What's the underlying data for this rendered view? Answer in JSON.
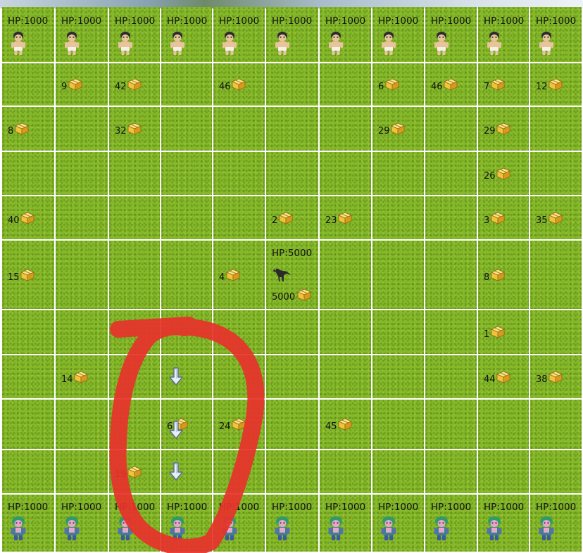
{
  "colors": {
    "grass": "#86b82a",
    "marker": "#e8312b",
    "crate": "#f2c23a",
    "top_figure_skin": "#e9c49a",
    "bottom_figure": "#3f7f8f"
  },
  "top_row": {
    "hp_label": "HP:1000",
    "columns": 11
  },
  "bottom_row": {
    "hp_label": "HP:1000",
    "columns": 11
  },
  "boss": {
    "hp_label": "HP:5000",
    "value": "5000",
    "icon": "dinosaur-icon"
  },
  "crates": [
    {
      "r": 1,
      "c": 1,
      "v": "9"
    },
    {
      "r": 1,
      "c": 2,
      "v": "42"
    },
    {
      "r": 1,
      "c": 4,
      "v": "46"
    },
    {
      "r": 1,
      "c": 7,
      "v": "6"
    },
    {
      "r": 1,
      "c": 8,
      "v": "46"
    },
    {
      "r": 1,
      "c": 9,
      "v": "7"
    },
    {
      "r": 1,
      "c": 10,
      "v": "12"
    },
    {
      "r": 2,
      "c": 0,
      "v": "8"
    },
    {
      "r": 2,
      "c": 2,
      "v": "32"
    },
    {
      "r": 2,
      "c": 7,
      "v": "29"
    },
    {
      "r": 2,
      "c": 9,
      "v": "29"
    },
    {
      "r": 3,
      "c": 9,
      "v": "26"
    },
    {
      "r": 4,
      "c": 0,
      "v": "40"
    },
    {
      "r": 4,
      "c": 5,
      "v": "2"
    },
    {
      "r": 4,
      "c": 6,
      "v": "23"
    },
    {
      "r": 4,
      "c": 9,
      "v": "3"
    },
    {
      "r": 4,
      "c": 10,
      "v": "35"
    },
    {
      "r": 5,
      "c": 0,
      "v": "15"
    },
    {
      "r": 5,
      "c": 4,
      "v": "4"
    },
    {
      "r": 5,
      "c": 9,
      "v": "8"
    },
    {
      "r": 6,
      "c": 9,
      "v": "1"
    },
    {
      "r": 7,
      "c": 1,
      "v": "14"
    },
    {
      "r": 7,
      "c": 9,
      "v": "44"
    },
    {
      "r": 7,
      "c": 10,
      "v": "38"
    },
    {
      "r": 8,
      "c": 3,
      "v": "6"
    },
    {
      "r": 8,
      "c": 4,
      "v": "24"
    },
    {
      "r": 8,
      "c": 6,
      "v": "45"
    },
    {
      "r": 9,
      "c": 2,
      "v": "19"
    }
  ],
  "arrows": [
    {
      "r": 7,
      "c": 3
    },
    {
      "r": 8,
      "c": 3
    },
    {
      "r": 9,
      "c": 3
    }
  ],
  "icons": {
    "crate": "crate-icon",
    "arrow": "down-arrow-icon",
    "top_figure": "warrior-icon",
    "bottom_figure": "green-hair-unit-icon",
    "annotation": "hand-drawn-circle"
  }
}
